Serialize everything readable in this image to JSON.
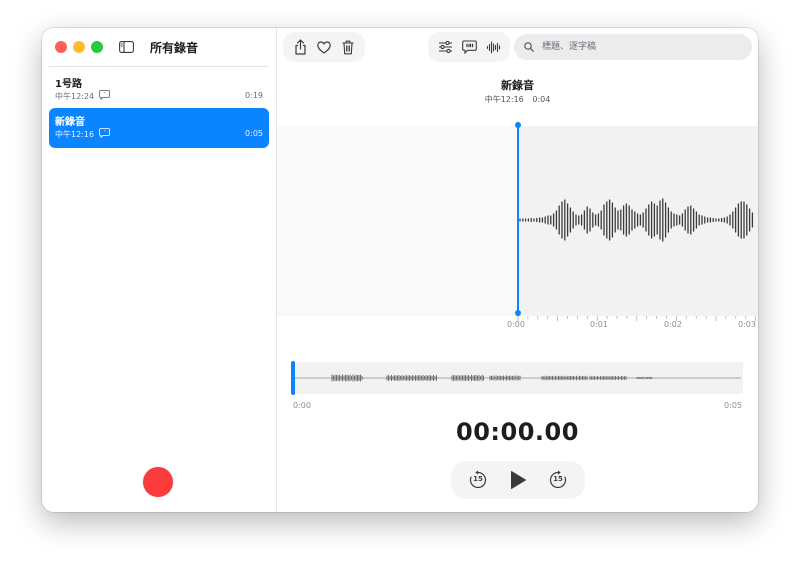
{
  "sidebar": {
    "title": "所有錄音",
    "recordings": [
      {
        "name": "1号路",
        "time": "中午12:24",
        "duration": "0:19",
        "selected": false
      },
      {
        "name": "新錄音",
        "time": "中午12:16",
        "duration": "0:05",
        "selected": true
      }
    ]
  },
  "toolbar": {
    "search_placeholder": "標題、逐字稿",
    "left_icons": [
      "share-icon",
      "heart-icon",
      "trash-icon"
    ],
    "mid_icons": [
      "sliders-icon",
      "transcript-icon",
      "waveform-icon"
    ]
  },
  "detail": {
    "title": "新錄音",
    "time": "中午12:16",
    "duration": "0:04",
    "ticks": [
      "0:00",
      "0:01",
      "0:02",
      "0:03"
    ],
    "overview_start": "0:00",
    "overview_end": "0:05",
    "timer": "00:00.00",
    "skip_back": "15",
    "skip_forward": "15"
  },
  "colors": {
    "accent": "#0a84ff",
    "record": "#fb3b3b",
    "waveform": "#3a3a3c"
  }
}
